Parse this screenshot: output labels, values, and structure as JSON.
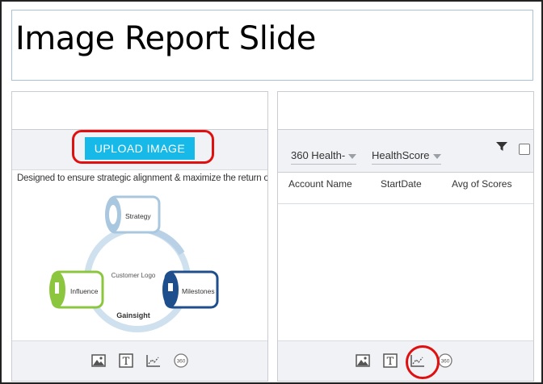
{
  "slide": {
    "title": "Image Report Slide"
  },
  "left_panel": {
    "upload_label": "UPLOAD IMAGE",
    "tagline": "Designed to ensure strategic alignment & maximize the return on your investment",
    "diagram": {
      "strategy": "Strategy",
      "influence": "Influence",
      "milestones": "Milestones",
      "customer_logo": "Customer Logo",
      "brand": "Gainsight"
    },
    "toolbar_icons": [
      "image-icon",
      "text-icon",
      "chart-icon",
      "360-icon"
    ]
  },
  "right_panel": {
    "dropdown_1": "360 Health-",
    "dropdown_2": "HealthScore",
    "columns": [
      "Account Name",
      "StartDate",
      "Avg of Scores"
    ],
    "toolbar_icons": [
      "image-icon",
      "text-icon",
      "chart-icon",
      "360-icon"
    ]
  },
  "icon_text": {
    "badge_360": "360",
    "text_glyph": "T"
  },
  "colors": {
    "accent": "#16b9e7",
    "highlight_ring": "#e01010",
    "influence": "#8cc63f",
    "milestones": "#1f4e8c",
    "strategy": "#a9c7de"
  }
}
